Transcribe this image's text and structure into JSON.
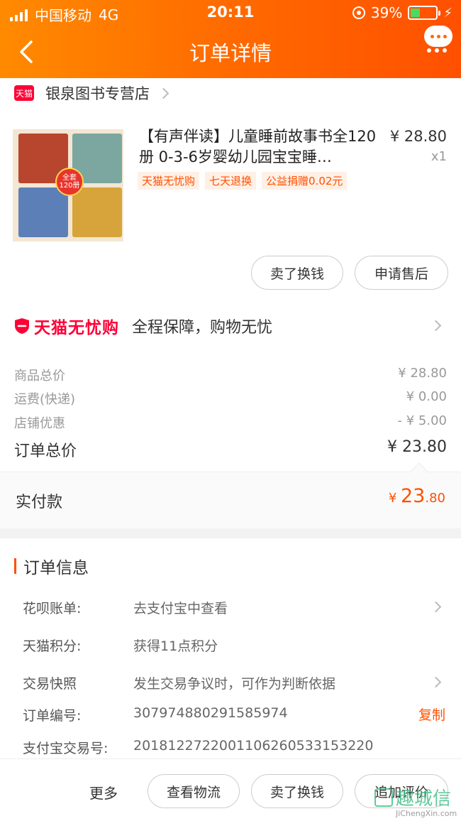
{
  "status_bar": {
    "carrier": "中国移动",
    "network": "4G",
    "time": "20:11",
    "battery": "39%",
    "battery_level": 0.39
  },
  "nav": {
    "title": "订单详情"
  },
  "shop": {
    "badge": "天猫",
    "name": "银泉图书专营店"
  },
  "product": {
    "title": "【有声伴读】儿童睡前故事书全120册 0-3-6岁婴幼儿园宝宝睡…",
    "price": "¥ 28.80",
    "qty": "x1",
    "cover_badge": "全套120册",
    "tags": [
      "天猫无忧购",
      "七天退换",
      "公益捐赠0.02元"
    ]
  },
  "product_actions": {
    "sell": "卖了换钱",
    "after_sale": "申请售后"
  },
  "guarantee": {
    "brand": "天猫无忧购",
    "text": "全程保障，购物无忧"
  },
  "summary": {
    "goods_label": "商品总价",
    "goods_value": "¥ 28.80",
    "shipping_label": "运费(快递)",
    "shipping_value": "¥ 0.00",
    "discount_label": "店铺优惠",
    "discount_value": "- ¥ 5.00",
    "total_label": "订单总价",
    "total_value": "¥ 23.80"
  },
  "paid": {
    "label": "实付款",
    "currency": "¥ ",
    "int": "23",
    "dec": ".80"
  },
  "order_info": {
    "title": "订单信息",
    "huabei_label": "花呗账单:",
    "huabei_value": "去支付宝中查看",
    "points_label": "天猫积分:",
    "points_value": "获得11点积分",
    "snapshot_label": "交易快照",
    "snapshot_value": "发生交易争议时，可作为判断依据",
    "order_no_label": "订单编号:",
    "order_no_value": "307974880291585974",
    "copy": "复制",
    "alipay_label": "支付宝交易号:",
    "alipay_value": "2018122722001106260533153220"
  },
  "footer": {
    "more": "更多",
    "logistics": "查看物流",
    "sell": "卖了换钱",
    "review": "追加评价"
  },
  "watermark": {
    "main": "趣城信",
    "sub": "JiChengXin.com"
  },
  "colors": {
    "accent": "#ff5000",
    "tmall_red": "#ff0036",
    "header_start": "#ff8a00",
    "header_end": "#ff5000"
  }
}
